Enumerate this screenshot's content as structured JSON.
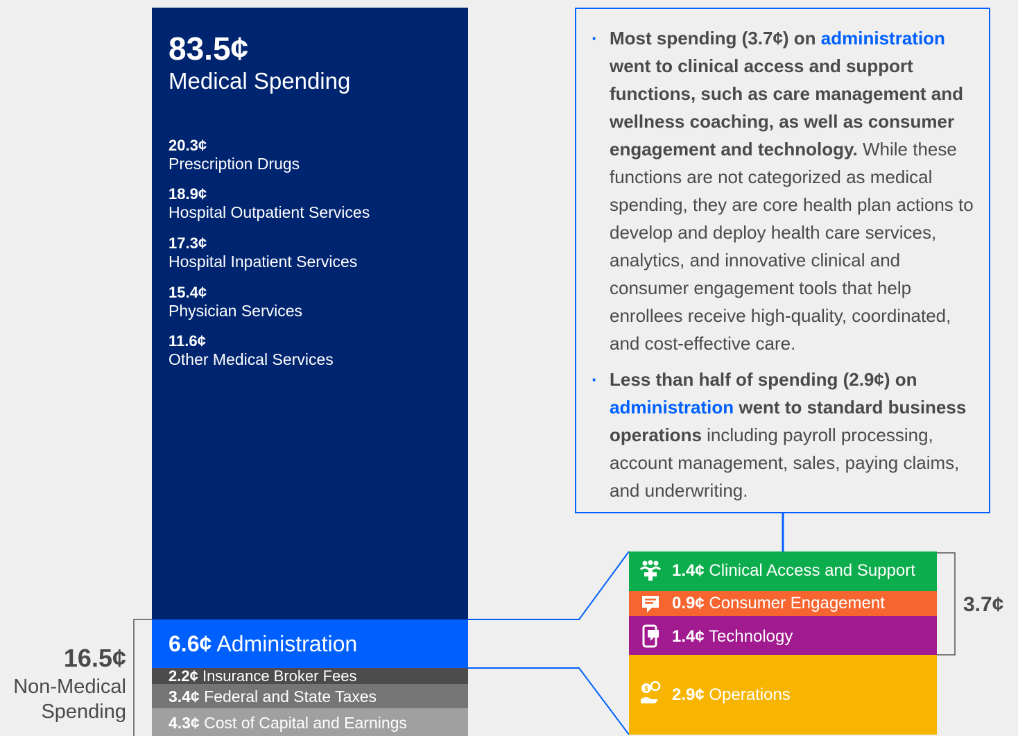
{
  "chart_data": {
    "type": "bar",
    "medical": {
      "value": "83.5¢",
      "label": "Medical Spending",
      "items": [
        {
          "value": "20.3¢",
          "label": "Prescription Drugs"
        },
        {
          "value": "18.9¢",
          "label": "Hospital Outpatient Services"
        },
        {
          "value": "17.3¢",
          "label": "Hospital Inpatient Services"
        },
        {
          "value": "15.4¢",
          "label": "Physician Services"
        },
        {
          "value": "11.6¢",
          "label": "Other Medical Services"
        }
      ]
    },
    "non_medical": {
      "value": "16.5¢",
      "label_line1": "Non-Medical",
      "label_line2": "Spending",
      "items": [
        {
          "value": "6.6¢",
          "label": "Administration"
        },
        {
          "value": "2.2¢",
          "label": "Insurance Broker Fees"
        },
        {
          "value": "3.4¢",
          "label": "Federal and State Taxes"
        },
        {
          "value": "4.3¢",
          "label": "Cost of Capital and Earnings"
        }
      ]
    },
    "administration_breakdown": {
      "bracket_value": "3.7¢",
      "items": [
        {
          "value": "1.4¢",
          "label": "Clinical Access and Support",
          "icon": "people-plus-icon",
          "color": "#0cad4c"
        },
        {
          "value": "0.9¢",
          "label": "Consumer Engagement",
          "icon": "chat-icon",
          "color": "#f66430"
        },
        {
          "value": "1.4¢",
          "label": "Technology",
          "icon": "phone-icon",
          "color": "#a11a8f"
        },
        {
          "value": "2.9¢",
          "label": "Operations",
          "icon": "money-hand-icon",
          "color": "#f7b500"
        }
      ]
    },
    "colors": {
      "medical": "#002570",
      "administration": "#0060ff",
      "broker": "#4c4c4c",
      "taxes": "#757575",
      "capital": "#a0a0a0"
    }
  },
  "callout": {
    "bullet1": {
      "bold_a": "Most spending (3.7¢) on ",
      "link": "administration",
      "bold_b": " went to clinical access and support functions, such as care management and wellness coaching, as well as consumer engagement and technology.",
      "text": " While these functions are not categorized as medical spending, they are core health plan actions to develop and deploy health care services, analytics, and innovative clinical and consumer engagement tools that help enrollees receive high-quality, coordinated, and cost-effective care."
    },
    "bullet2": {
      "bold_a": "Less than half of spending (2.9¢) on ",
      "link": "administration",
      "bold_b": " went to standard business operations",
      "text": " including payroll processing, account management, sales, paying claims, and underwriting."
    }
  }
}
